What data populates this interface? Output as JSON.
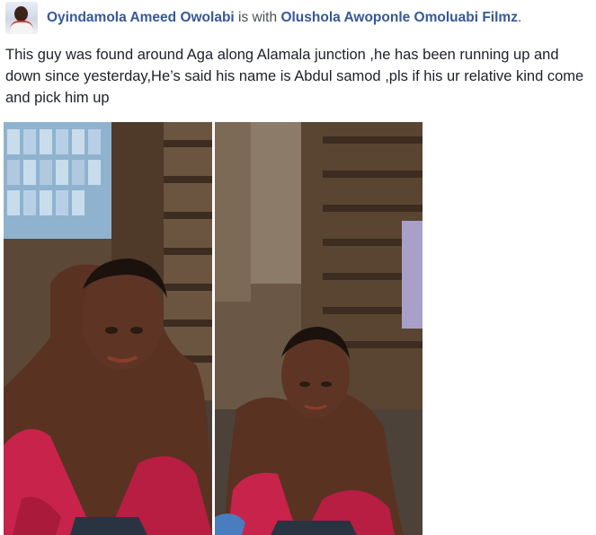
{
  "post": {
    "author": "Oyindamola Ameed Owolabi",
    "connector": "is with",
    "tagged": "Olushola Awoponle Omoluabi Filmz",
    "terminator": ".",
    "body": "This guy was found around Aga along Alamala junction ,he has been running up and down since yesterday,He’s said his name is Abdul samod ,pls if his ur relative kind come and pick him up"
  },
  "photos": [
    {
      "label": "photo-1"
    },
    {
      "label": "photo-2"
    }
  ],
  "colors": {
    "link": "#365899",
    "text": "#1d2129",
    "muted": "#4b4f56",
    "jacket": "#c8234a",
    "skin": "#5a3222"
  }
}
